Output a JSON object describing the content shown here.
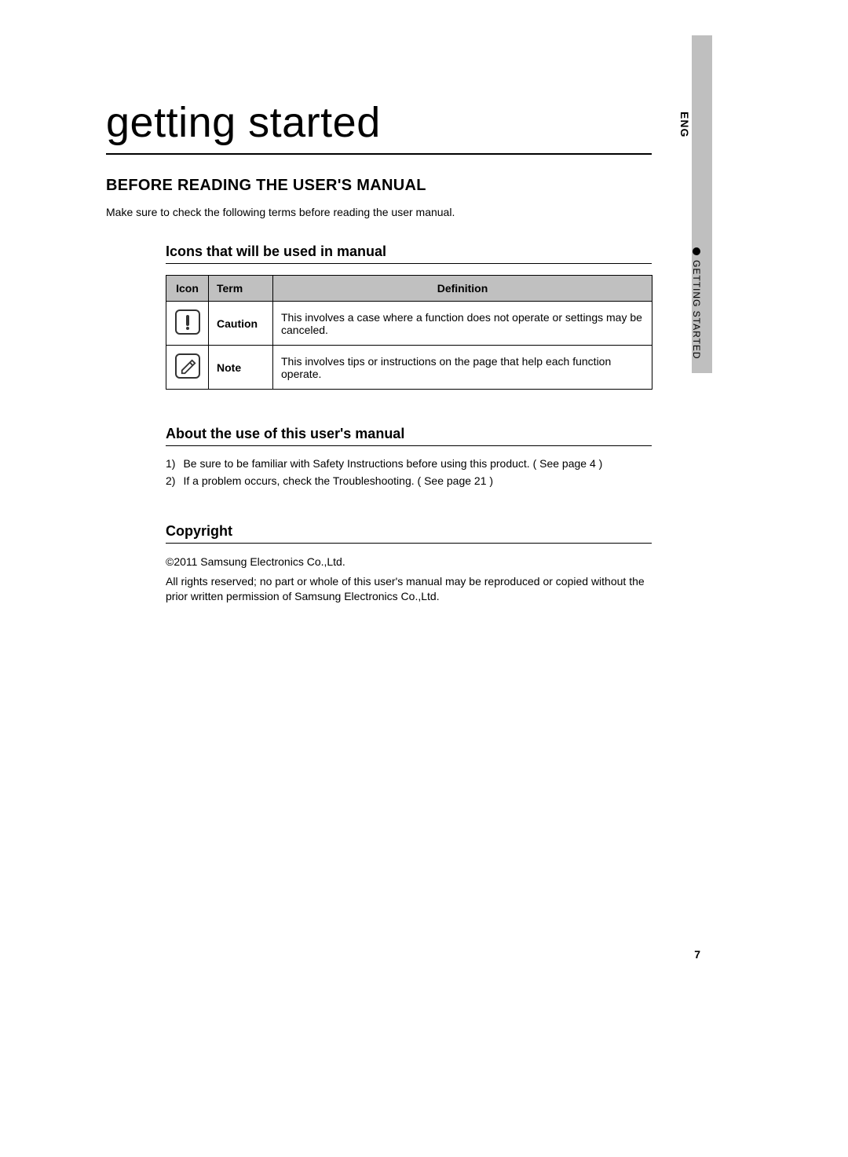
{
  "title": "getting started",
  "heading1": "BEFORE READING THE USER'S MANUAL",
  "intro": "Make sure to check the following terms before reading the user manual.",
  "section_icons_heading": "Icons that will be used in manual",
  "table": {
    "headers": {
      "icon": "Icon",
      "term": "Term",
      "definition": "Definition"
    },
    "rows": [
      {
        "term": "Caution",
        "definition": "This involves a case where a function does not operate or settings may be canceled."
      },
      {
        "term": "Note",
        "definition": "This involves tips or instructions on the page that help each function operate."
      }
    ]
  },
  "section_about_heading": "About the use of this user's manual",
  "about_items": [
    "Be sure to be familiar with Safety Instructions before using this product. ( See page 4 )",
    "If a problem occurs, check the Troubleshooting. ( See page 21 )"
  ],
  "section_copyright_heading": "Copyright",
  "copyright_line1": "©2011 Samsung Electronics Co.,Ltd.",
  "copyright_line2": "All rights reserved; no part or whole of this user's manual may be reproduced or copied without the prior written permission of Samsung Electronics Co.,Ltd.",
  "sidebar": {
    "lang": "ENG",
    "section": "GETTING STARTED"
  },
  "page_number": "7"
}
